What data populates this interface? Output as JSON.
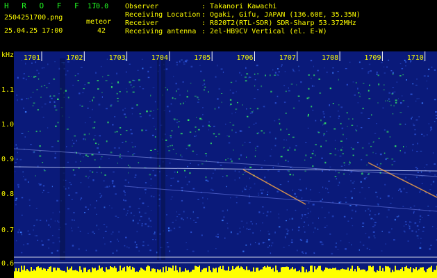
{
  "header": {
    "brand": "H R O F F T",
    "version": "1.0.0",
    "filename": "2504251700.png",
    "datetime": "25.04.25 17:00",
    "meteor_label": "meteor",
    "meteor_count": "42",
    "fields": [
      {
        "key": "Observer",
        "value": ": Takanori Kawachi"
      },
      {
        "key": "Receiving Location",
        "value": ": Ogaki, Gifu, JAPAN (136.60E, 35.35N)"
      },
      {
        "key": "Receiver",
        "value": ": R820T2(RTL-SDR) SDR-Sharp 53.372MHz"
      },
      {
        "key": "Receiving antenna",
        "value": ": 2el-HB9CV Vertical (el. E-W)"
      }
    ]
  },
  "spectrogram": {
    "y_unit": "kHz",
    "y_ticks": [
      "1.1",
      "1.0",
      "0.9",
      "0.8",
      "0.7",
      "0.6"
    ],
    "x_ticks": [
      "1701",
      "1702",
      "1703",
      "1704",
      "1705",
      "1706",
      "1707",
      "1708",
      "1709",
      "1710"
    ],
    "colors": {
      "background": "#0a1a7a",
      "signal": "#33dd66",
      "strong": "#ff6633",
      "baseline": "#ffff00"
    }
  }
}
